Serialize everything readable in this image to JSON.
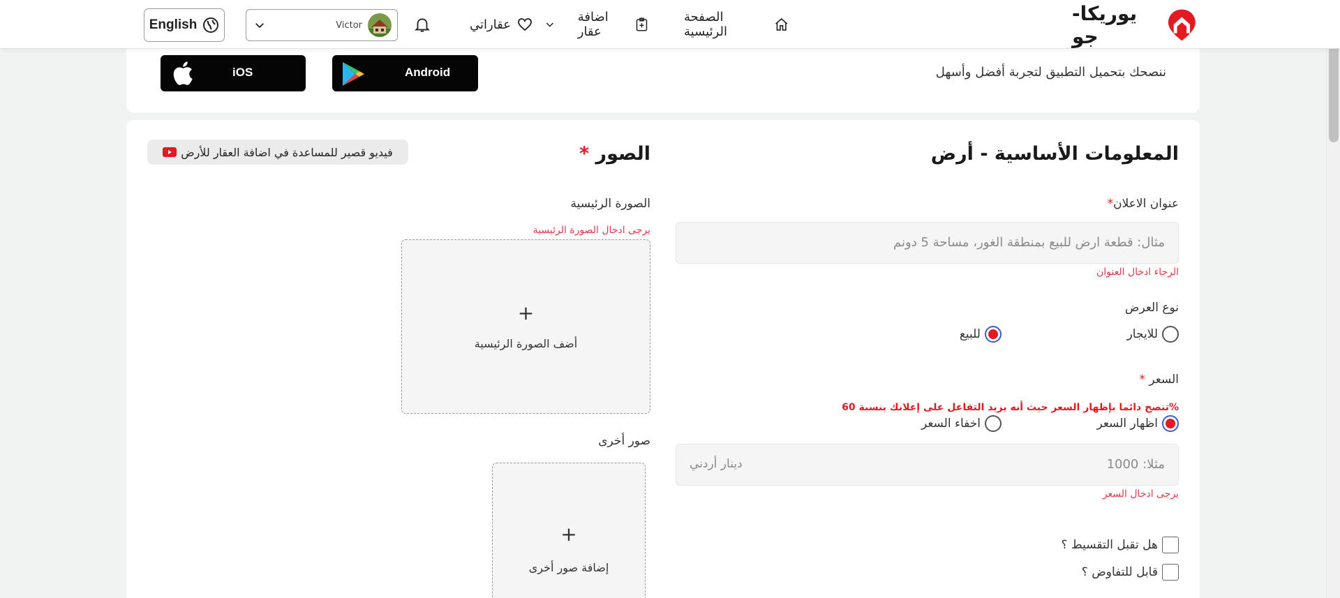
{
  "brand": {
    "name": "يوريكا-جو",
    "accent": "#e21b23"
  },
  "nav": {
    "home_label": "الصفحة الرئيسية",
    "add_label": "اضافة عقار",
    "fav_label": "عقاراتي",
    "user_name": "Victor",
    "language_label": "English"
  },
  "banner": {
    "text": "ننصحك بتحميل التطبيق لتجربة أفضل وأسهل",
    "ios_label": "iOS",
    "android_label": "Android"
  },
  "basic_info": {
    "title": "المعلومات الأساسية - أرض",
    "ad_title_label": "عنوان الاعلان",
    "ad_title_placeholder": "مثال: قطعة ارض للبيع بمنطقة الغور، مساحة 5 دونم",
    "ad_title_error": "الرجاء ادخال العنوان",
    "offer_type_label": "نوع العرض",
    "offer_types": [
      {
        "label": "للايجار",
        "selected": false
      },
      {
        "label": "للبيع",
        "selected": true
      }
    ],
    "price_label": "السعر",
    "price_hint": "تنصح دائما بإظهار السعر حيث أنه يزيد التفاعل على إعلانك بنسبة 60%",
    "price_visibility": [
      {
        "label": "اظهار السعر",
        "selected": true
      },
      {
        "label": "اخفاء السعر",
        "selected": false
      }
    ],
    "price_placeholder": "مثلا: 1000",
    "currency": "دينار أردني",
    "price_error": "يرجى ادخال السعر",
    "installment_label": "هل تقبل التقسيط ؟",
    "negotiable_label": "قابل للتفاوض ؟"
  },
  "photos": {
    "title": "الصور",
    "video_help": "فيديو قصير للمساعدة في اضافة العقار للأرض",
    "main_label": "الصورة الرئيسية",
    "main_error": "يرجى ادخال الصورة الرئيسية",
    "main_plus": "+",
    "main_upload_label": "أضف الصورة الرئيسية",
    "other_label": "صور أخرى",
    "other_plus": "+",
    "other_upload_label": "إضافة صور أخرى"
  },
  "icons": {
    "home": "home-icon",
    "add": "add-property-icon",
    "heart": "heart-icon",
    "bell": "bell-icon",
    "globe": "globe-icon",
    "apple": "apple-icon",
    "play": "google-play-icon",
    "youtube": "youtube-icon"
  }
}
